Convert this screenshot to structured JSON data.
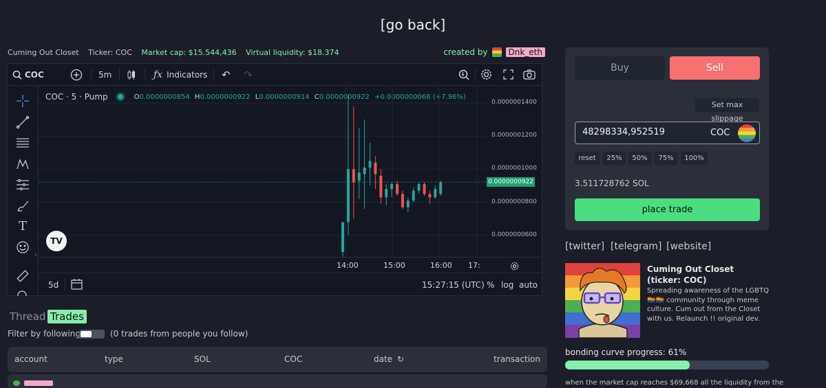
{
  "header": {
    "go_back": "[go back]"
  },
  "token_info": {
    "name": "Cuming Out Closet",
    "ticker": "Ticker: COC",
    "market_cap": "Market cap: $15.544,436",
    "virtual_liquidity": "Virtual liquidity: $18.374",
    "created_by_label": "created by",
    "creator": "Dnk_eth"
  },
  "chart_toolbar": {
    "symbol": "COC",
    "interval": "5m",
    "indicators": "Indicators"
  },
  "chart_legend": {
    "title": "COC · 5 · Pump",
    "o_label": "O",
    "o": "0.0000000854",
    "h_label": "H",
    "h": "0.0000000922",
    "l_label": "L",
    "l": "0.0000000914",
    "c_label": "C",
    "c": "0.0000000922",
    "change": "+0.0000000068 (+7.96%)"
  },
  "chart_data": {
    "type": "candlestick",
    "series_name": "COC",
    "y_ticks": [
      "0.0000001400",
      "0.0000001200",
      "0.0000001000",
      "0.0000000800",
      "0.0000000600"
    ],
    "x_ticks": [
      "14:00",
      "15:00",
      "16:00",
      "17:"
    ],
    "current_price": "0.0000000922",
    "ylim": [
      4.7e-08,
      1.5e-07
    ],
    "candles": [
      {
        "o": 5e-08,
        "h": 6.8e-08,
        "l": 4.7e-08,
        "c": 6.8e-08
      },
      {
        "o": 6.8e-08,
        "h": 1.45e-07,
        "l": 6e-08,
        "c": 1e-07
      },
      {
        "o": 1e-07,
        "h": 1.38e-07,
        "l": 7e-08,
        "c": 9.2e-08
      },
      {
        "o": 9.3e-08,
        "h": 1.25e-07,
        "l": 8.2e-08,
        "c": 9.8e-08
      },
      {
        "o": 9.7e-08,
        "h": 1.3e-07,
        "l": 7.6e-08,
        "c": 1.01e-07
      },
      {
        "o": 1.01e-07,
        "h": 1.16e-07,
        "l": 9e-08,
        "c": 1.05e-07
      },
      {
        "o": 1.04e-07,
        "h": 1.08e-07,
        "l": 8.8e-08,
        "c": 9.7e-08
      },
      {
        "o": 9.6e-08,
        "h": 1e-07,
        "l": 7.9e-08,
        "c": 8.3e-08
      },
      {
        "o": 8.3e-08,
        "h": 9.1e-08,
        "l": 7.8e-08,
        "c": 8.8e-08
      },
      {
        "o": 8.8e-08,
        "h": 9.2e-08,
        "l": 8.3e-08,
        "c": 9.1e-08
      },
      {
        "o": 9.1e-08,
        "h": 9.3e-08,
        "l": 8.4e-08,
        "c": 8.5e-08
      },
      {
        "o": 8.5e-08,
        "h": 8.7e-08,
        "l": 7.6e-08,
        "c": 7.7e-08
      },
      {
        "o": 7.7e-08,
        "h": 8.3e-08,
        "l": 7.4e-08,
        "c": 8.1e-08
      },
      {
        "o": 8.1e-08,
        "h": 8.9e-08,
        "l": 8e-08,
        "c": 8.7e-08
      },
      {
        "o": 8.7e-08,
        "h": 9.2e-08,
        "l": 8.5e-08,
        "c": 9.1e-08
      },
      {
        "o": 9.1e-08,
        "h": 9.2e-08,
        "l": 8.4e-08,
        "c": 8.5e-08
      },
      {
        "o": 8.5e-08,
        "h": 8.7e-08,
        "l": 7.9e-08,
        "c": 8.3e-08
      },
      {
        "o": 8.3e-08,
        "h": 9e-08,
        "l": 8.2e-08,
        "c": 8.8e-08
      },
      {
        "o": 8.5e-08,
        "h": 9.3e-08,
        "l": 8.4e-08,
        "c": 9.2e-08
      }
    ],
    "colors": {
      "up": "#26a69a",
      "down": "#ef5350"
    }
  },
  "chart_bottom": {
    "range": "5d",
    "time": "15:27:15 (UTC)",
    "percent": "%",
    "log": "log",
    "auto": "auto"
  },
  "tabs": {
    "thread": "Thread",
    "trades": "Trades"
  },
  "filter": {
    "label": "Filter by following",
    "info": "(0 trades from people you follow)"
  },
  "trades_table": {
    "columns": [
      "account",
      "type",
      "SOL",
      "COC",
      "date",
      "transaction"
    ]
  },
  "trade_panel": {
    "buy": "Buy",
    "sell": "Sell",
    "slippage": "Set max slippage",
    "amount": "48298334,952519",
    "currency": "COC",
    "quick": [
      "reset",
      "25%",
      "50%",
      "75%",
      "100%"
    ],
    "output": "3.511728762 SOL",
    "place_trade": "place trade"
  },
  "links": {
    "twitter": "[twitter]",
    "telegram": "[telegram]",
    "website": "[website]"
  },
  "token_card": {
    "title": "Cuming Out Closet (ticker: COC)",
    "description": "Spreading awareness of the LGBTQ 🏳️‍🌈🏳️‍🌈 community through meme culture. Cum out from the Closet with us. Relaunch !! original dev."
  },
  "bonding": {
    "label": "bonding curve progress: 61%",
    "progress": 0.61
  },
  "footer_text": "when the market cap reaches $69,668 all the liquidity from the",
  "colors": {
    "accent_green": "#86efac",
    "sell_red": "#f87171",
    "trade_green": "#4ade80"
  }
}
